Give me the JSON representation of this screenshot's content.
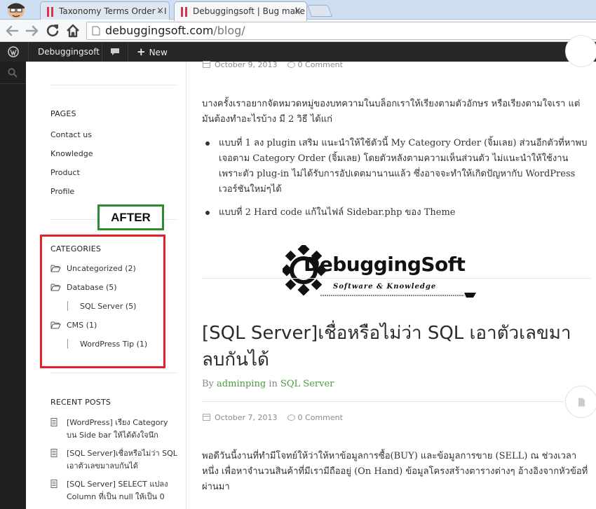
{
  "browser": {
    "tabs": [
      {
        "label": "Taxonomy Terms Order ‹ I",
        "active": false
      },
      {
        "label": "Debuggingsoft | Bug make",
        "active": true
      }
    ],
    "close_glyph": "×",
    "url_host": "debuggingsoft.com",
    "url_path": "/blog/"
  },
  "adminbar": {
    "site_name": "Debuggingsoft",
    "new_label": "New",
    "new_glyph": "+"
  },
  "sidebar": {
    "pages_title": "PAGES",
    "pages": [
      "Contact us",
      "Knowledge",
      "Product",
      "Profile"
    ],
    "categories_title": "CATEGORIES",
    "categories": [
      {
        "label": "Uncategorized (2)"
      },
      {
        "label": "Database (5)"
      },
      {
        "label": "SQL Server (5)"
      },
      {
        "label": "CMS (1)"
      },
      {
        "label": "WordPress Tip (1)"
      }
    ],
    "recent_title": "RECENT POSTS",
    "recent_posts": [
      "[WordPress] เรียง Category บน Side bar ให้ได้ดังใจนึก",
      "[SQL Server]เชื่อหรือไม่ว่า SQL เอาตัวเลขมาลบกันได้",
      "[SQL Server] SELECT แปลง Column ที่เป็น null ให้เป็น 0"
    ]
  },
  "annotation": {
    "after_label": "AFTER"
  },
  "main": {
    "post1": {
      "date": "October 9, 2013",
      "comments": "0 Comment",
      "intro": "บางครั้งเราอยากจัดหมวดหมู่ของบทความในบล็อกเราให้เรียงตามตัวอักษร หรือเรียงตามใจเรา แต่มันต้องทำอะไรบ้าง มี 2 วิธี ได้แก่",
      "bullets": [
        "แบบที่ 1 ลง plugin เสริม แนะนำให้ใช้ตัวนี้ My Category Order (จิ้มเลย) ส่วนอีกตัวที่หาพบเจอตาม Category Order (จิ้มเลย) โดยตัวหลังตามความเห็นส่วนตัว ไม่แนะนำให้ใช้งาน เพราะตัว plug-in ไม่ได้รับการอัปเดตมานานแล้ว ซึ่งอาจจะทำให้เกิดปัญหากับ WordPress เวอร์ชันใหม่ๆได้",
        "แบบที่ 2 Hard code แก้ในไฟล์ Sidebar.php ของ Theme"
      ],
      "logo_text": "DebuggingSoft",
      "logo_tagline": "Software & Knowledge"
    },
    "post2": {
      "title": "[SQL Server]เชื่อหรือไม่ว่า SQL เอาตัวเลขมาลบกันได้",
      "by": "By",
      "author": "adminping",
      "in": "in",
      "category": "SQL Server",
      "date": "October 7, 2013",
      "comments": "0 Comment",
      "intro": "พอดีวันนี้งานที่ทำมีโจทย์ให้ว่าให้หาข้อมูลการซื้อ(BUY) และข้อมูลการขาย (SELL) ณ ช่วงเวลาหนึ่ง เพื่อหาจำนวนสินค้าที่มีเรามีถืออยู่ (On Hand) ข้อมูลโครงสร้างตารางต่างๆ อ้างอิงจากหัวข้อที่ผ่านมา"
    }
  },
  "colors": {
    "accent_green": "#4a9b3e",
    "annotation_red": "#e32227",
    "annotation_green": "#2e8b2e",
    "adminbar_bg": "#262626"
  }
}
